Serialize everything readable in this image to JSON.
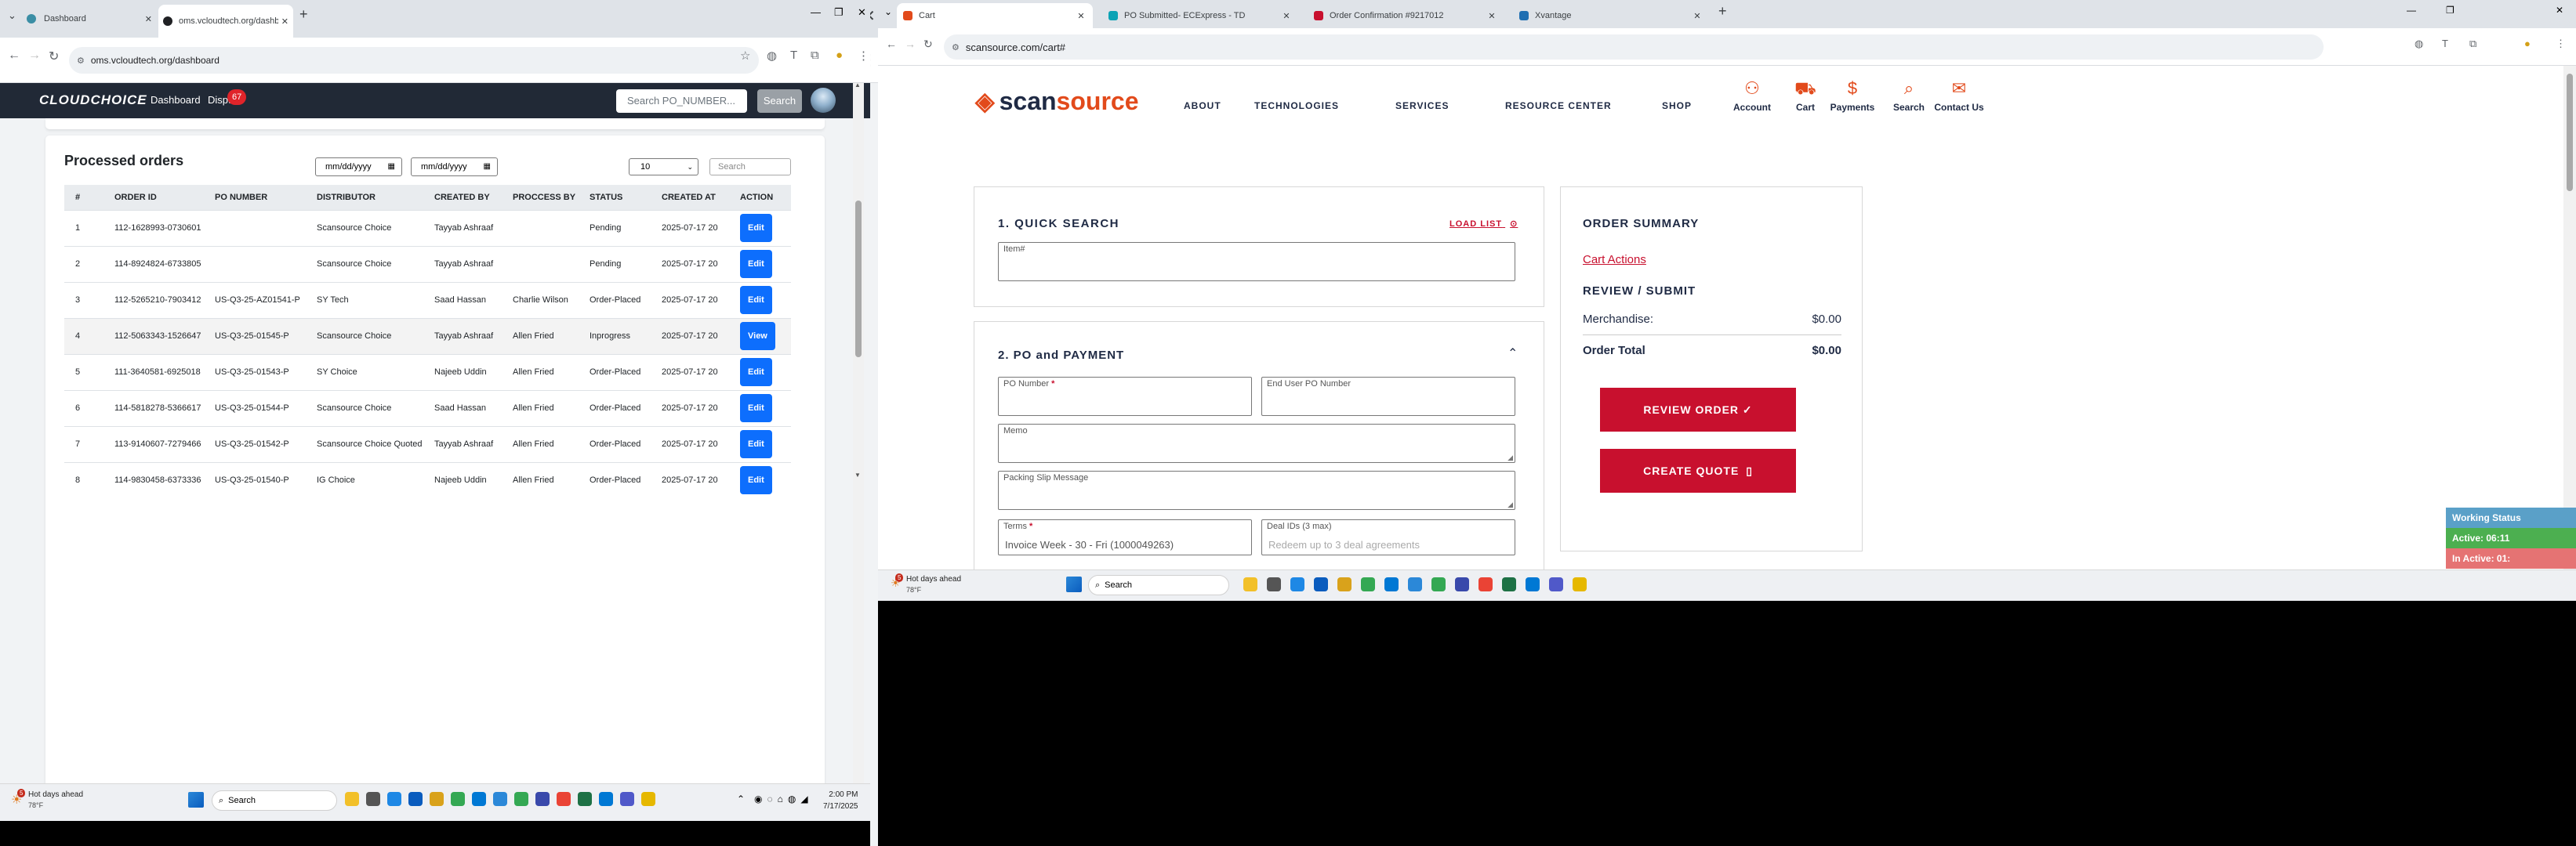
{
  "left_browser": {
    "tabs": [
      {
        "title": "Dashboard",
        "active": false
      },
      {
        "title": "oms.vcloudtech.org/dashboard",
        "active": true
      }
    ],
    "new_tab": "+",
    "url": "oms.vcloudtech.org/dashboard"
  },
  "app": {
    "logo": "CLOUDCHOICE",
    "nav": {
      "dashboard": "Dashboard",
      "disputes": "Disputes",
      "disputes_badge": "67"
    },
    "search_placeholder": "Search PO_NUMBER...",
    "search_button": "Search"
  },
  "orders": {
    "title": "Processed orders",
    "date_from": "mm/dd/yyyy",
    "date_to": "mm/dd/yyyy",
    "page_size": "10",
    "search_placeholder": "Search",
    "columns": [
      "#",
      "ORDER ID",
      "PO NUMBER",
      "DISTRIBUTOR",
      "CREATED BY",
      "PROCCESS BY",
      "STATUS",
      "CREATED AT",
      "ACTION"
    ],
    "rows": [
      {
        "n": "1",
        "order_id": "112-1628993-0730601",
        "po": "",
        "distributor": "Scansource Choice",
        "created_by": "Tayyab Ashraaf",
        "process_by": "",
        "status": "Pending",
        "created_at": "2025-07-17 20",
        "action": "Edit"
      },
      {
        "n": "2",
        "order_id": "114-8924824-6733805",
        "po": "",
        "distributor": "Scansource Choice",
        "created_by": "Tayyab Ashraaf",
        "process_by": "",
        "status": "Pending",
        "created_at": "2025-07-17 20",
        "action": "Edit"
      },
      {
        "n": "3",
        "order_id": "112-5265210-7903412",
        "po": "US-Q3-25-AZ01541-P",
        "distributor": "SY Tech",
        "created_by": "Saad Hassan",
        "process_by": "Charlie Wilson",
        "status": "Order-Placed",
        "created_at": "2025-07-17 20",
        "action": "Edit"
      },
      {
        "n": "4",
        "order_id": "112-5063343-1526647",
        "po": "US-Q3-25-01545-P",
        "distributor": "Scansource Choice",
        "created_by": "Tayyab Ashraaf",
        "process_by": "Allen Fried",
        "status": "Inprogress",
        "created_at": "2025-07-17 20",
        "action": "View"
      },
      {
        "n": "5",
        "order_id": "111-3640581-6925018",
        "po": "US-Q3-25-01543-P",
        "distributor": "SY Choice",
        "created_by": "Najeeb Uddin",
        "process_by": "Allen Fried",
        "status": "Order-Placed",
        "created_at": "2025-07-17 20",
        "action": "Edit"
      },
      {
        "n": "6",
        "order_id": "114-5818278-5366617",
        "po": "US-Q3-25-01544-P",
        "distributor": "Scansource Choice",
        "created_by": "Saad Hassan",
        "process_by": "Allen Fried",
        "status": "Order-Placed",
        "created_at": "2025-07-17 20",
        "action": "Edit"
      },
      {
        "n": "7",
        "order_id": "113-9140607-7279466",
        "po": "US-Q3-25-01542-P",
        "distributor": "Scansource Choice Quoted",
        "created_by": "Tayyab Ashraaf",
        "process_by": "Allen Fried",
        "status": "Order-Placed",
        "created_at": "2025-07-17 20",
        "action": "Edit"
      },
      {
        "n": "8",
        "order_id": "114-9830458-6373336",
        "po": "US-Q3-25-01540-P",
        "distributor": "IG Choice",
        "created_by": "Najeeb Uddin",
        "process_by": "Allen Fried",
        "status": "Order-Placed",
        "created_at": "2025-07-17 20",
        "action": "Edit"
      }
    ]
  },
  "left_taskbar": {
    "weather_title": "Hot days ahead",
    "weather_temp": "78°F",
    "weather_badge": "5",
    "search": "Search",
    "time": "2:00 PM",
    "date": "7/17/2025"
  },
  "right_browser": {
    "tabs": [
      {
        "title": "Cart",
        "active": true
      },
      {
        "title": "PO Submitted- ECExpress - TD",
        "active": false
      },
      {
        "title": "Order Confirmation #9217012",
        "active": false
      },
      {
        "title": "Xvantage",
        "active": false
      }
    ],
    "new_tab": "+",
    "url": "scansource.com/cart#"
  },
  "scansource": {
    "logo_scan": "scan",
    "logo_source": "source",
    "nav": [
      "ABOUT",
      "TECHNOLOGIES",
      "SERVICES",
      "RESOURCE CENTER",
      "SHOP"
    ],
    "icons": [
      {
        "label": "Account",
        "icon": "person-icon"
      },
      {
        "label": "Cart",
        "icon": "cart-icon"
      },
      {
        "label": "Payments",
        "icon": "dollar-icon"
      },
      {
        "label": "Search",
        "icon": "search-icon"
      },
      {
        "label": "Contact Us",
        "icon": "chat-icon"
      }
    ],
    "quick_search": {
      "title": "1. QUICK SEARCH",
      "load_list": "LOAD LIST",
      "item_label": "Item#"
    },
    "po_payment": {
      "title": "2. PO and PAYMENT",
      "po_number_label": "PO Number",
      "end_user_po_label": "End User PO Number",
      "memo_label": "Memo",
      "packing_slip_label": "Packing Slip Message",
      "terms_label": "Terms",
      "terms_value": "Invoice Week - 30 - Fri (1000049263)",
      "deal_ids_label": "Deal IDs (3 max)",
      "deal_ids_placeholder": "Redeem up to 3 deal agreements",
      "required_mark": "*"
    },
    "summary": {
      "title": "ORDER SUMMARY",
      "cart_actions": "Cart Actions",
      "review_submit": "REVIEW / SUBMIT",
      "merch_label": "Merchandise:",
      "merch_value": "$0.00",
      "total_label": "Order Total",
      "total_value": "$0.00",
      "review_btn": "REVIEW ORDER ✓",
      "quote_btn": "CREATE QUOTE"
    }
  },
  "side_widgets": [
    "Working Status",
    "Active: 06:11",
    "In Active: 01:"
  ],
  "right_taskbar": {
    "weather_title": "Hot days ahead",
    "weather_temp": "78°F",
    "weather_badge": "5",
    "search": "Search"
  }
}
